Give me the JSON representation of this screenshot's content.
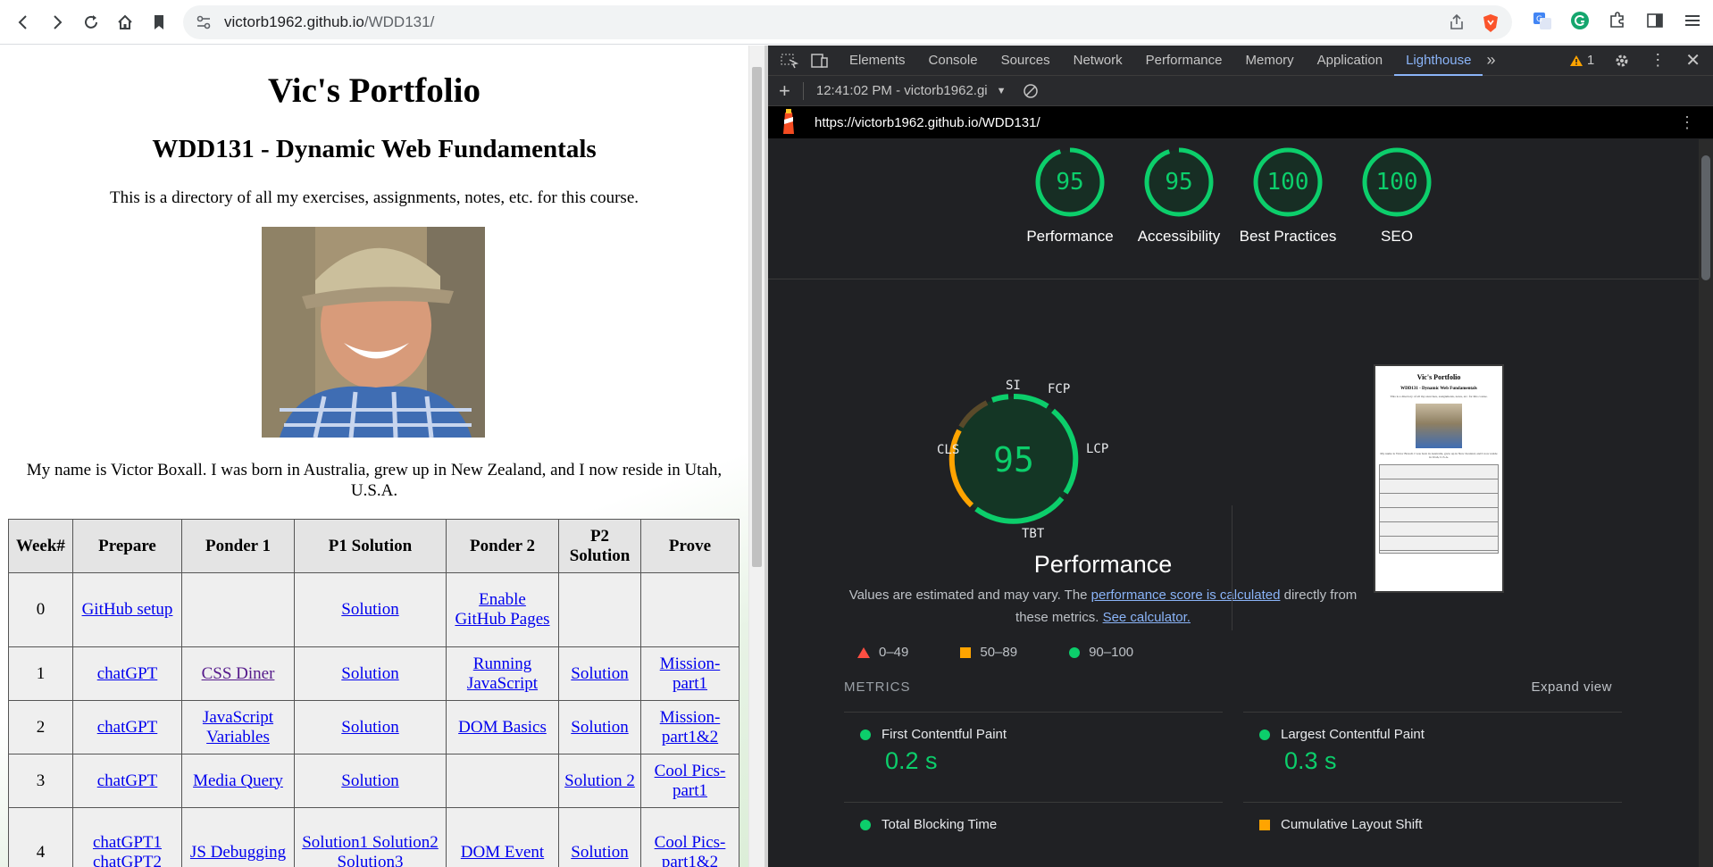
{
  "browser": {
    "url_host": "victorb1962.github.io",
    "url_path": "/WDD131/"
  },
  "page": {
    "title": "Vic's Portfolio",
    "subtitle": "WDD131 - Dynamic Web Fundamentals",
    "intro": "This is a directory of all my exercises, assignments, notes, etc. for this course.",
    "bio": "My name is Victor Boxall. I was born in Australia, grew up in New Zealand, and I now reside in Utah, U.S.A.",
    "table": {
      "headers": [
        "Week#",
        "Prepare",
        "Ponder 1",
        "P1 Solution",
        "Ponder 2",
        "P2 Solution",
        "Prove"
      ],
      "rows": [
        [
          "0",
          "GitHub setup",
          "",
          "Solution",
          "Enable GitHub Pages",
          "",
          ""
        ],
        [
          "1",
          "chatGPT",
          "CSS Diner",
          "Solution",
          "Running JavaScript",
          "Solution",
          "Mission-part1"
        ],
        [
          "2",
          "chatGPT",
          "JavaScript Variables",
          "Solution",
          "DOM Basics",
          "Solution",
          "Mission-part1&2"
        ],
        [
          "3",
          "chatGPT",
          "Media Query",
          "Solution",
          "",
          "Solution 2",
          "Cool Pics-part1"
        ],
        [
          "4",
          "chatGPT1 chatGPT2",
          "JS Debugging",
          "Solution1 Solution2 Solution3",
          "DOM Event",
          "Solution",
          "Cool Pics-part1&2"
        ]
      ]
    }
  },
  "devtools": {
    "tabs": [
      "Elements",
      "Console",
      "Sources",
      "Network",
      "Performance",
      "Memory",
      "Application",
      "Lighthouse"
    ],
    "active_tab": "Lighthouse",
    "warning_count": "1",
    "report_select": "12:41:02 PM - victorb1962.gi",
    "report_url": "https://victorb1962.github.io/WDD131/",
    "scores": [
      {
        "name": "Performance",
        "value": "95",
        "fraction": 0.95
      },
      {
        "name": "Accessibility",
        "value": "95",
        "fraction": 0.95
      },
      {
        "name": "Best Practices",
        "value": "100",
        "fraction": 1.0
      },
      {
        "name": "SEO",
        "value": "100",
        "fraction": 1.0
      }
    ],
    "perf_gauge": {
      "score": "95",
      "labels": {
        "si": "SI",
        "fcp": "FCP",
        "lcp": "LCP",
        "tbt": "TBT",
        "cls": "CLS"
      },
      "title": "Performance"
    },
    "perf_desc_prefix": "Values are estimated and may vary. The ",
    "perf_desc_link": "performance score is calculated",
    "perf_desc_mid": " directly from these metrics. ",
    "perf_desc_link2": "See calculator.",
    "legend": [
      "0–49",
      "50–89",
      "90–100"
    ],
    "metrics_heading": "METRICS",
    "expand_label": "Expand view",
    "metrics": [
      {
        "name": "First Contentful Paint",
        "value": "0.2 s"
      },
      {
        "name": "Largest Contentful Paint",
        "value": "0.3 s"
      },
      {
        "name": "Total Blocking Time",
        "value": ""
      },
      {
        "name": "Cumulative Layout Shift",
        "value": ""
      }
    ],
    "colors": {
      "pass": "#0cce6b",
      "average": "#ffa400",
      "fail": "#ff4e42",
      "accent": "#8ab4f8"
    }
  }
}
